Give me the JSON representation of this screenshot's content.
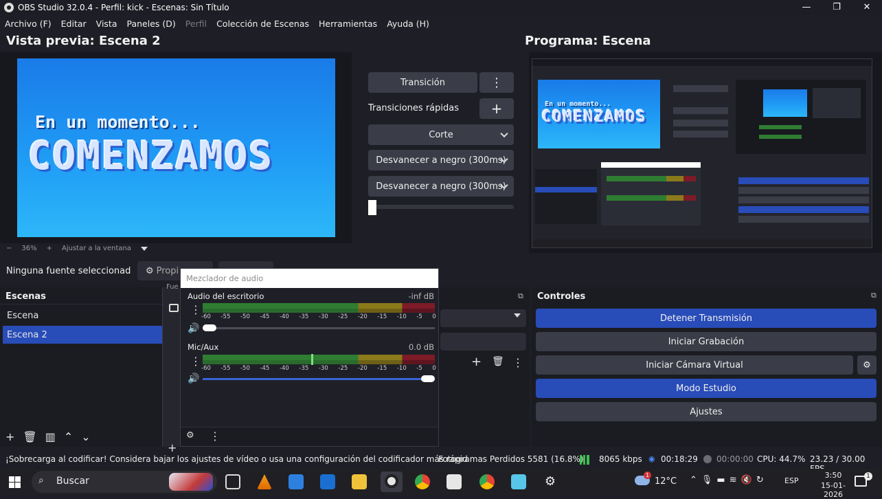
{
  "window": {
    "title": "OBS Studio 32.0.4 - Perfil: kick - Escenas: Sin Título",
    "minimize": "—",
    "maximize": "❐",
    "close": "✕"
  },
  "menu": [
    "Archivo (F)",
    "Editar",
    "Vista",
    "Paneles (D)",
    "Perfil",
    "Colección de Escenas",
    "Herramientas",
    "Ayuda (H)"
  ],
  "preview": {
    "title": "Vista previa: Escena 2",
    "canvas_line1": "En un momento...",
    "canvas_line2": "COMENZAMOS",
    "zoom_minus": "−",
    "zoom": "36%",
    "zoom_plus": "+",
    "fit": "Ajustar a la ventana"
  },
  "transition": {
    "button": "Transición",
    "quick_label": "Transiciones rápidas",
    "items": [
      "Corte",
      "Desvanecer a negro (300ms)",
      "Desvanecer a negro (300ms)"
    ]
  },
  "program": {
    "title": "Programa: Escena"
  },
  "source_bar": {
    "no_source": "Ninguna fuente seleccionad",
    "properties": "Propi",
    "sources_partial": "Fue"
  },
  "scenes": {
    "title": "Escenas",
    "items": [
      "Escena",
      "Escena 2"
    ],
    "selected_index": 1
  },
  "mixer": {
    "header": "Mezclador de audio",
    "ticks": [
      "-60",
      "-55",
      "-50",
      "-45",
      "-40",
      "-35",
      "-30",
      "-25",
      "-20",
      "-15",
      "-10",
      "-5",
      "0"
    ],
    "channels": [
      {
        "name": "Audio del escritorio",
        "db": "-inf dB",
        "volume": 0.0
      },
      {
        "name": "Mic/Aux",
        "db": "0.0 dB",
        "volume": 1.0
      }
    ]
  },
  "controls": {
    "title": "Controles",
    "buttons": [
      "Detener Transmisión",
      "Iniciar Grabación",
      "Iniciar Cámara Virtual",
      "Modo Estudio",
      "Ajustes"
    ]
  },
  "status": {
    "warning": "¡Sobrecarga al codificar! Considera bajar los ajustes de vídeo o usa una configuración del codificador más rápid",
    "dropped": "Fotogramas Perdidos 5581 (16.8%)",
    "bitrate": "8065 kbps",
    "stream_time": "00:18:29",
    "rec_time": "00:00:00",
    "cpu": "CPU: 44.7%",
    "fps": "23.23 / 30.00 FPS"
  },
  "taskbar": {
    "search": "Buscar",
    "weather": "12°C",
    "lang": "ESP",
    "time": "3:50",
    "date": "15-01-2026",
    "notif_count": "1"
  },
  "colors": {
    "accent": "#284cb8",
    "button": "#3a3c47",
    "background": "#1e1f26"
  }
}
